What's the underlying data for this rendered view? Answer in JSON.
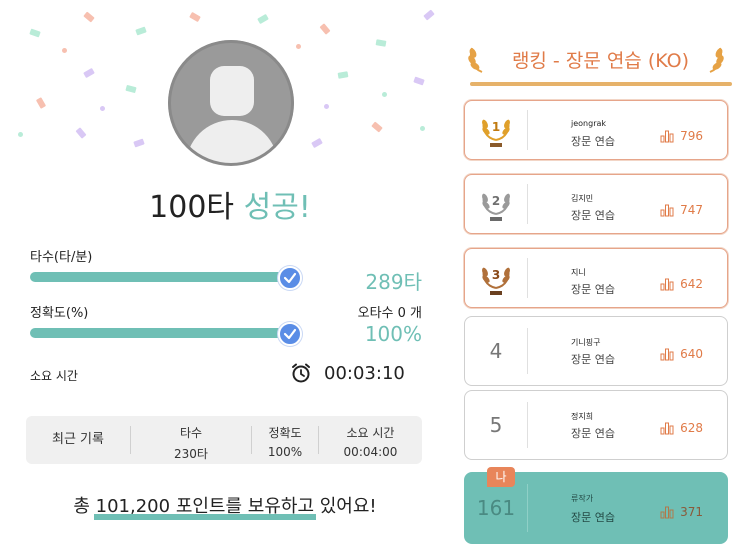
{
  "result": {
    "headline_number": "100타",
    "headline_success": "성공!",
    "speed_label": "타수(타/분)",
    "speed_value": "289타",
    "accuracy_label": "정확도(%)",
    "typo_count": "오타수 0 개",
    "accuracy_value": "100%",
    "time_label": "소요 시간",
    "time_value": "00:03:10",
    "speed_progress": 1.0,
    "accuracy_progress": 1.0
  },
  "recent": {
    "label": "최근 기록",
    "speed_header": "타수",
    "speed_value": "230타",
    "accuracy_header": "정확도",
    "accuracy_value": "100%",
    "time_header": "소요 시간",
    "time_value": "00:04:00"
  },
  "points": {
    "prefix": "총 ",
    "highlight": "101,200 포인트를 보유하고",
    "suffix": " 있어요!"
  },
  "ranking": {
    "title": "랭킹 - 장문 연습 (KO)",
    "entries": [
      {
        "rank": "1",
        "name": "jeongrak",
        "mode": "장문 연습",
        "score": "796",
        "medal": "gold"
      },
      {
        "rank": "2",
        "name": "김지민",
        "mode": "장문 연습",
        "score": "747",
        "medal": "silver"
      },
      {
        "rank": "3",
        "name": "지니",
        "mode": "장문 연습",
        "score": "642",
        "medal": "bronze"
      },
      {
        "rank": "4",
        "name": "기니핑구",
        "mode": "장문 연습",
        "score": "640"
      },
      {
        "rank": "5",
        "name": "정지희",
        "mode": "장문 연습",
        "score": "628"
      },
      {
        "rank": "161",
        "name": "류작가",
        "mode": "장문 연습",
        "score": "371",
        "badge": "나"
      }
    ]
  },
  "colors": {
    "accent": "#6fbfb5",
    "orange": "#e07b48",
    "check": "#5a8de6",
    "gold": "#e6b26a"
  }
}
